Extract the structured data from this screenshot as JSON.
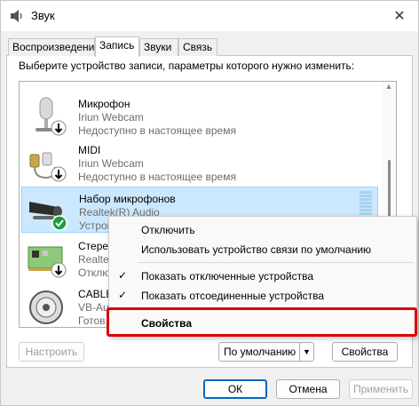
{
  "window": {
    "title": "Звук",
    "close_glyph": "✕"
  },
  "tabs": [
    {
      "label": "Воспроизведение",
      "active": false
    },
    {
      "label": "Запись",
      "active": true
    },
    {
      "label": "Звуки",
      "active": false
    },
    {
      "label": "Связь",
      "active": false
    }
  ],
  "instruction": "Выберите устройство записи, параметры которого нужно изменить:",
  "devices": [
    {
      "name": "Микрофон",
      "sub1": "Iriun Webcam",
      "sub2": "Недоступно в настоящее время",
      "icon": "microphone-icon",
      "status": "down-arrow"
    },
    {
      "name": "MIDI",
      "sub1": "Iriun Webcam",
      "sub2": "Недоступно в настоящее время",
      "icon": "midi-cable-icon",
      "status": "down-arrow"
    },
    {
      "name": "Набор микрофонов",
      "sub1": "Realtek(R) Audio",
      "sub2": "Устройство по умолчанию",
      "sub2_visible": "Устройс",
      "icon": "microphone-array-icon",
      "status": "green-check",
      "selected": true
    },
    {
      "name": "Стерео",
      "sub1": "Realtek",
      "sub2": "Отключено",
      "name_visible": "Стерес",
      "sub1_visible": "Realte",
      "sub2_visible": "Отклю",
      "icon": "sound-card-icon",
      "status": "down-arrow"
    },
    {
      "name": "CABLE",
      "sub1": "VB-Audio",
      "sub2": "Готов",
      "name_visible": "CABLE",
      "sub1_visible": "VB-Au",
      "sub2_visible": "Готов",
      "icon": "speaker-icon",
      "status": "none"
    }
  ],
  "context_menu": {
    "items": [
      {
        "label": "Отключить",
        "checked": false
      },
      {
        "label": "Использовать устройство связи по умолчанию",
        "checked": false
      },
      {
        "label": "Показать отключенные устройства",
        "checked": true
      },
      {
        "label": "Показать отсоединенные устройства",
        "checked": true
      },
      {
        "label": "Свойства",
        "checked": false,
        "bold": true
      }
    ],
    "check_glyph": "✓"
  },
  "buttons": {
    "configure": "Настроить",
    "default": "По умолчанию",
    "dropdown_glyph": "▼",
    "properties": "Свойства",
    "ok": "ОК",
    "cancel": "Отмена",
    "apply": "Применить"
  },
  "colors": {
    "selection": "#cce8ff",
    "highlight": "#d80000",
    "accent": "#0067c0",
    "check_green": "#1e9e3a"
  }
}
